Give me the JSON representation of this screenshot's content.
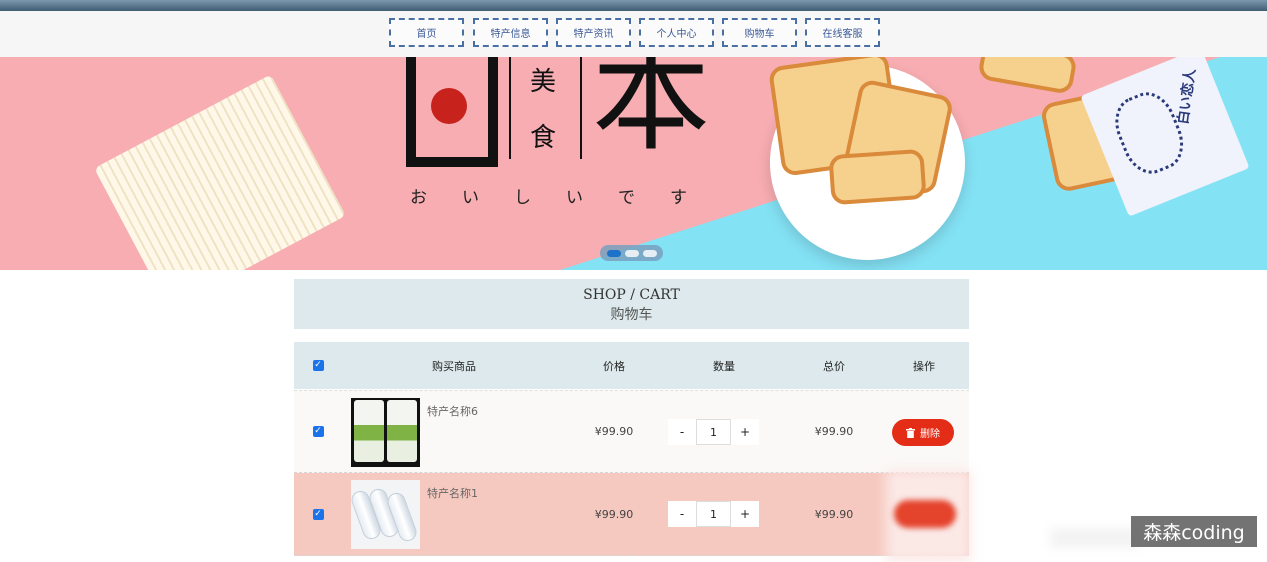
{
  "nav": {
    "items": [
      "首页",
      "特产信息",
      "特产资讯",
      "个人中心",
      "购物车",
      "在线客服"
    ]
  },
  "banner": {
    "char_big": "本",
    "char_mei": "美",
    "char_shi": "食",
    "kana": [
      "お",
      "い",
      "し",
      "い",
      "で",
      "す"
    ],
    "pack_text": "白い恋人",
    "carousel_total": 3,
    "carousel_active": 1
  },
  "cart": {
    "title_en": "SHOP / CART",
    "title_cn": "购物车"
  },
  "table": {
    "headers": {
      "product": "购买商品",
      "price": "价格",
      "quantity": "数量",
      "total": "总价",
      "action": "操作"
    }
  },
  "rows": [
    {
      "name": "特产名称6",
      "price": "¥99.90",
      "qty": "1",
      "total": "¥99.90",
      "delete_label": "删除",
      "minus": "-",
      "plus": "+"
    },
    {
      "name": "特产名称1",
      "price": "¥99.90",
      "qty": "1",
      "total": "¥99.90",
      "minus": "-",
      "plus": "+"
    }
  ],
  "watermark": "森森coding",
  "colors": {
    "nav_border": "#4a6fa5",
    "header_bg": "#dde9ec",
    "delete_button": "#e42d16",
    "selected_row": "#f6c9c0",
    "checkbox": "#1a73e8"
  },
  "icons": {
    "checkbox": "check-icon",
    "delete": "trash-icon"
  }
}
